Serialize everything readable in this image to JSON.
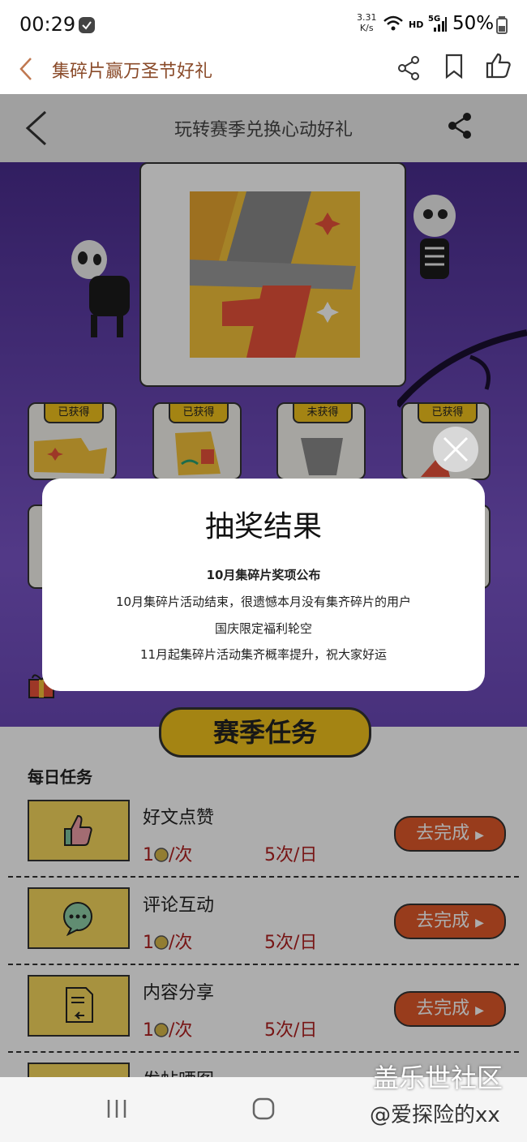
{
  "status_bar": {
    "time": "00:29",
    "net_speed_value": "3.31",
    "net_speed_unit": "K/s",
    "network": "5G",
    "hd": "HD",
    "battery": "50%"
  },
  "app_header": {
    "title": "集碎片赢万圣节好礼"
  },
  "page_header": {
    "title": "玩转赛季兑换心动好礼"
  },
  "fragments": [
    {
      "status": "已获得"
    },
    {
      "status": "已获得"
    },
    {
      "status": "未获得"
    },
    {
      "status": "已获得"
    }
  ],
  "tasks_section": {
    "banner": "赛季任务",
    "daily_label": "每日任务",
    "items": [
      {
        "name": "好文点赞",
        "reward_num": "1",
        "reward_unit": "/次",
        "limit": "5次/日",
        "button": "去完成",
        "icon": "thumbs-up-icon"
      },
      {
        "name": "评论互动",
        "reward_num": "1",
        "reward_unit": "/次",
        "limit": "5次/日",
        "button": "去完成",
        "icon": "comment-bubble-icon"
      },
      {
        "name": "内容分享",
        "reward_num": "1",
        "reward_unit": "/次",
        "limit": "5次/日",
        "button": "去完成",
        "icon": "share-document-icon"
      },
      {
        "name": "发帖晒图"
      }
    ]
  },
  "modal": {
    "title": "抽奖结果",
    "subtitle": "10月集碎片奖项公布",
    "lines": [
      "10月集碎片活动结束，很遗憾本月没有集齐碎片的用户",
      "国庆限定福利轮空",
      "11月起集碎片活动集齐概率提升，祝大家好运"
    ]
  },
  "watermark": {
    "brand": "盖乐世社区",
    "handle": "@爱探险的xx"
  }
}
